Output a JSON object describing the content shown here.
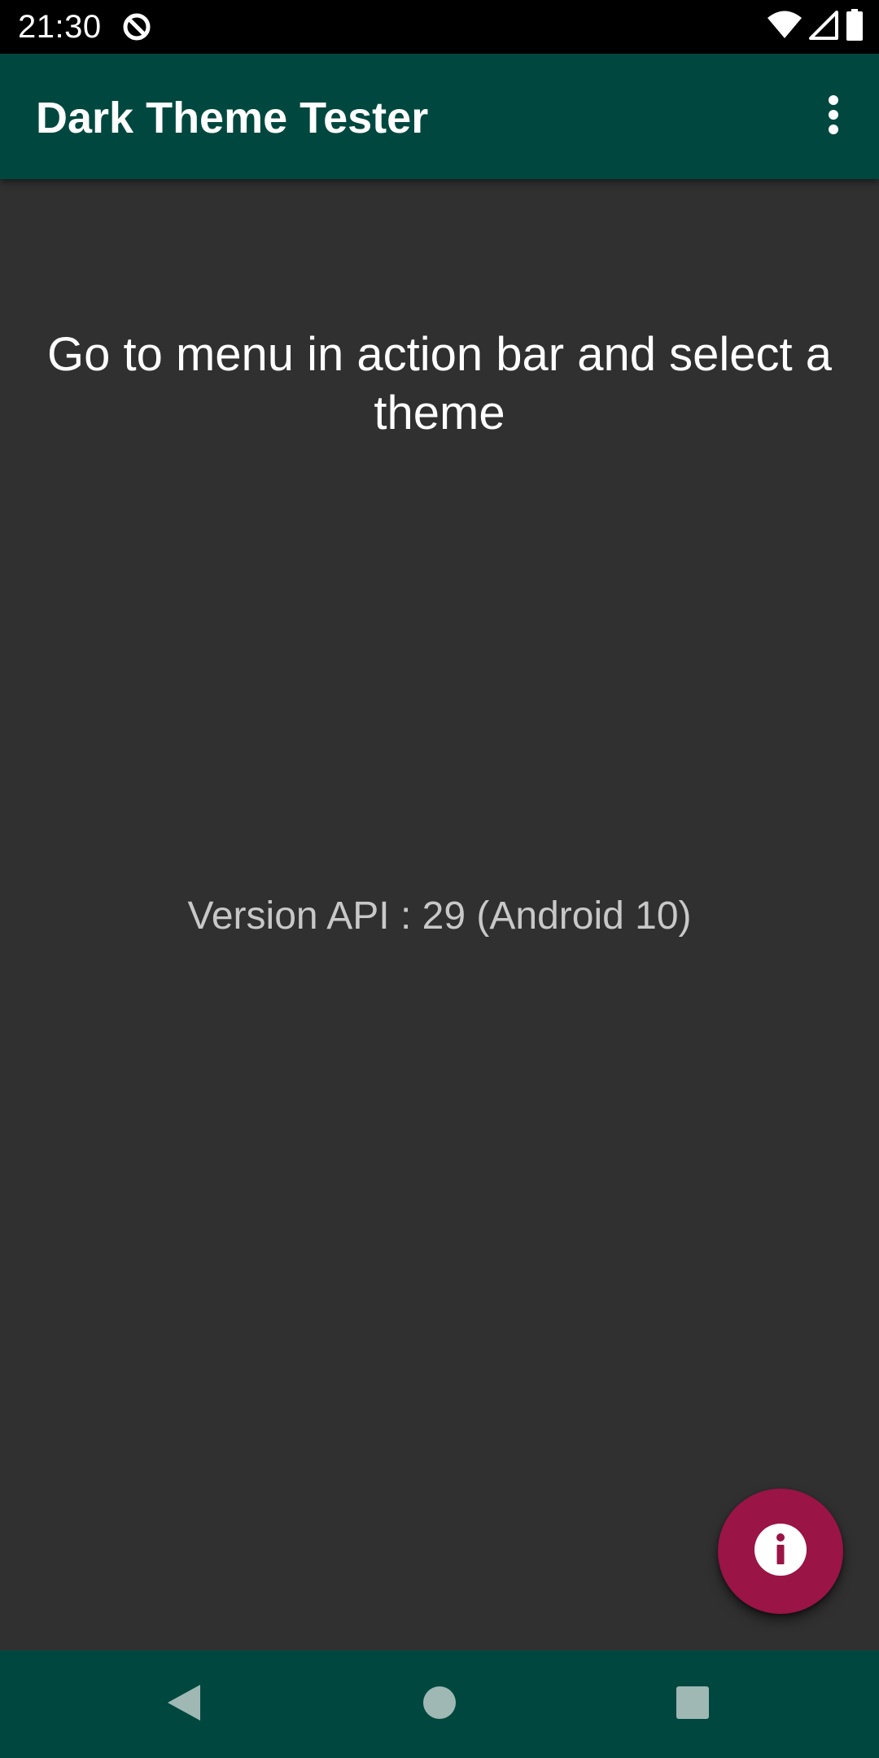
{
  "status_bar": {
    "time": "21:30",
    "app_icon": "data-saver-icon",
    "icons": [
      "wifi-icon",
      "signal-icon",
      "battery-icon"
    ]
  },
  "app_bar": {
    "title": "Dark Theme Tester",
    "overflow_icon": "more-vert-icon"
  },
  "main": {
    "instruction": "Go to menu in action bar and select a theme",
    "version_text": "Version API : 29 (Android 10)"
  },
  "fab": {
    "icon": "info-icon",
    "color": "#9a1446"
  },
  "nav_bar": {
    "buttons": [
      "back-icon",
      "home-icon",
      "recents-icon"
    ]
  },
  "colors": {
    "primary": "#00483f",
    "background": "#303030",
    "accent": "#9a1446",
    "status_bar": "#000000"
  }
}
